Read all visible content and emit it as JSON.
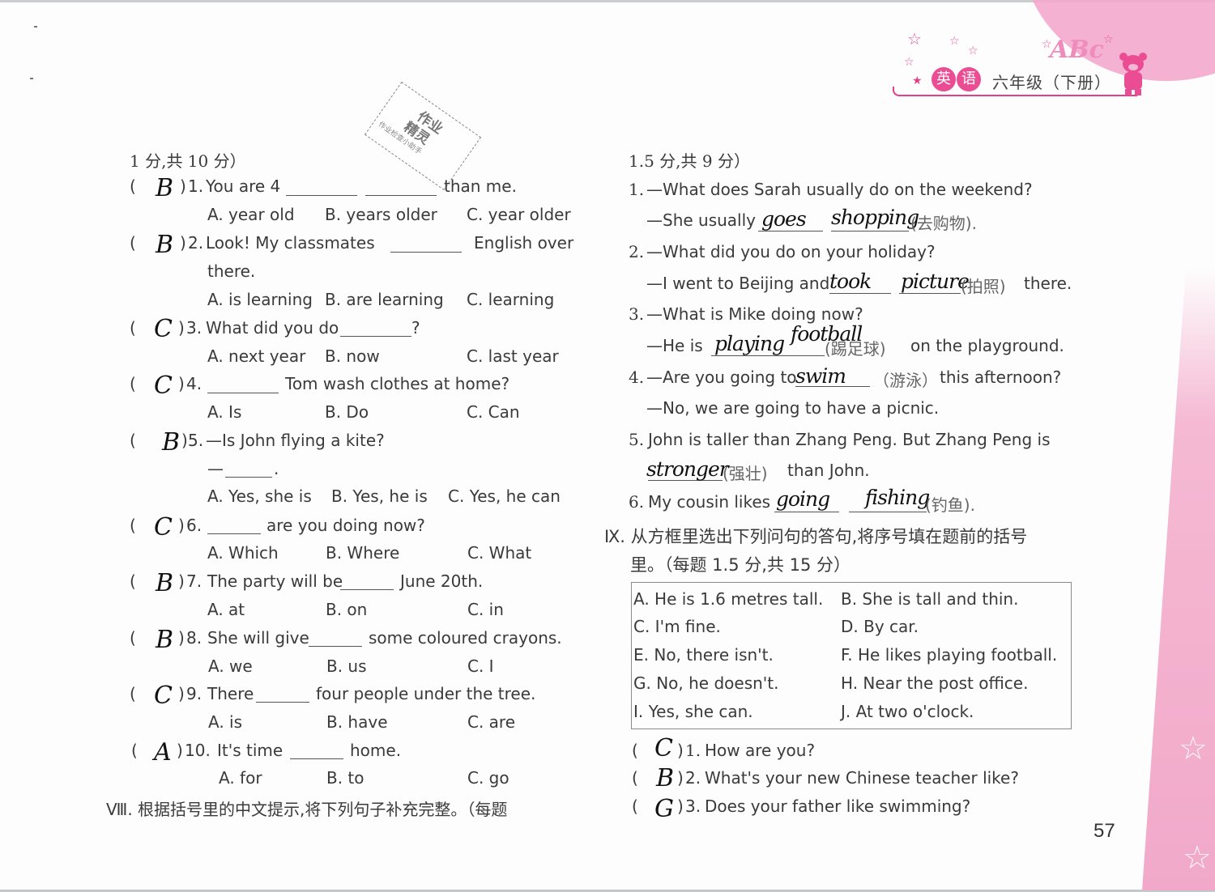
{
  "header": {
    "subject_badges": [
      "英",
      "语"
    ],
    "grade": "六年级（下册）",
    "decoration_letters": "ABc"
  },
  "stamp": {
    "title_line1": "作业",
    "title_line2": "精灵",
    "caption": "作业检查小助手"
  },
  "left_column": {
    "section_tail": "1 分,共 10 分）",
    "questions": [
      {
        "answer": "B",
        "number": "1.",
        "stem_before": "You are 4",
        "stem_after": "than me.",
        "options": [
          "A. year old",
          "B. years older",
          "C. year older"
        ]
      },
      {
        "answer": "B",
        "number": "2.",
        "stem_before": "Look!  My  classmates",
        "stem_after": "English  over",
        "stem_line2": "there.",
        "options": [
          "A. is learning",
          "B. are learning",
          "C. learning"
        ]
      },
      {
        "answer": "C",
        "number": "3.",
        "stem_before": "What did you do",
        "stem_after": "?",
        "options": [
          "A. next year",
          "B. now",
          "C. last year"
        ]
      },
      {
        "answer": "C",
        "number": "4.",
        "stem_before": "",
        "stem_after": "Tom wash clothes at home?",
        "options": [
          "A. Is",
          "B. Do",
          "C. Can"
        ]
      },
      {
        "answer": "B",
        "number": "5.",
        "stem_before": "—Is John flying a kite?",
        "stem_line2": "—",
        "options": [
          "A. Yes, she is",
          "B. Yes, he is",
          "C. Yes, he can"
        ]
      },
      {
        "answer": "C",
        "number": "6.",
        "stem_before": "",
        "stem_after": "are you doing now?",
        "options": [
          "A. Which",
          "B. Where",
          "C. What"
        ]
      },
      {
        "answer": "B",
        "number": "7.",
        "stem_before": "The party will be",
        "stem_after": "June 20th.",
        "options": [
          "A. at",
          "B. on",
          "C.  in"
        ]
      },
      {
        "answer": "B",
        "number": "8.",
        "stem_before": "She will give",
        "stem_after": "some coloured crayons.",
        "options": [
          "A. we",
          "B. us",
          "C. I"
        ]
      },
      {
        "answer": "C",
        "number": "9.",
        "stem_before": "There",
        "stem_after": "four people under the tree.",
        "options": [
          "A. is",
          "B. have",
          "C. are"
        ]
      },
      {
        "answer": "A",
        "number": "10.",
        "stem_before": "It's time",
        "stem_after": "home.",
        "options": [
          "A.  for",
          "B. to",
          "C. go"
        ]
      }
    ],
    "section8_heading": "Ⅷ. 根据括号里的中文提示,将下列句子补充完整。（每题"
  },
  "right_column": {
    "section_tail": "1.5 分,共 9 分）",
    "fill_items": [
      {
        "number": "1.",
        "line1": "—What does Sarah usually do on the weekend?",
        "line2_before": "—She usually",
        "handwritten": [
          "goes",
          "shopping"
        ],
        "hint": "(去购物).",
        "line2_after": ""
      },
      {
        "number": "2.",
        "line1": "—What did you do on your holiday?",
        "line2_before": "—I went to Beijing and",
        "handwritten": [
          "took",
          "picture"
        ],
        "hint": "(拍照)",
        "line2_after": "there."
      },
      {
        "number": "3.",
        "line1": "—What is Mike doing now?",
        "line2_before": "—He is",
        "handwritten": [
          "playing",
          "football"
        ],
        "hint": "(踢足球)",
        "line2_after": "on the playground."
      },
      {
        "number": "4.",
        "line1_before": "—Are you going to",
        "handwritten": [
          "swim"
        ],
        "hint": "（游泳）",
        "line1_after": "this afternoon?",
        "line2": "—No, we are going to have a picnic."
      },
      {
        "number": "5.",
        "line1": "John  is  taller  than  Zhang  Peng.  But  Zhang  Peng  is",
        "handwritten": [
          "stronger"
        ],
        "hint": "(强壮)",
        "line2_after": "than John."
      },
      {
        "number": "6.",
        "line1_before": "My cousin likes",
        "handwritten": [
          "going",
          "fishing"
        ],
        "hint": "(钓鱼)."
      }
    ],
    "section9_heading_line1": "Ⅸ. 从方框里选出下列问句的答句,将序号填在题前的括号",
    "section9_heading_line2": "里。（每题 1.5 分,共 15 分）",
    "choices": [
      [
        "A. He is 1.6 metres tall.",
        "B. She is tall and thin."
      ],
      [
        "C. I'm fine.",
        "D. By car."
      ],
      [
        "E. No, there isn't.",
        "F. He likes playing football."
      ],
      [
        "G. No, he doesn't.",
        "H. Near the post office."
      ],
      [
        "I. Yes, she can.",
        "J. At two o'clock."
      ]
    ],
    "match_questions": [
      {
        "answer": "C",
        "number": "1.",
        "text": "How are you?"
      },
      {
        "answer": "B",
        "number": "2.",
        "text": "What's your new Chinese teacher like?"
      },
      {
        "answer": "G",
        "number": "3.",
        "text": "Does your father like swimming?"
      }
    ]
  },
  "page_number": "57",
  "colors": {
    "accent_pink": "#ea4d93",
    "soft_pink": "#f3a9cc",
    "text": "#3a3a3a",
    "handwriting": "#111111"
  }
}
